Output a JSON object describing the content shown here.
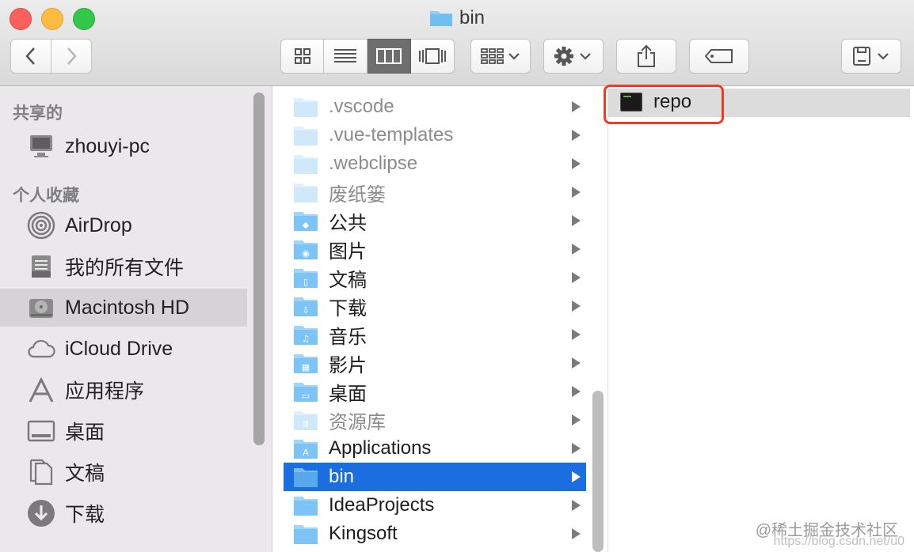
{
  "window": {
    "title": "bin"
  },
  "toolbar": {
    "back": "back",
    "forward": "forward",
    "view_modes": [
      "icon-view",
      "list-view",
      "column-view",
      "cover-flow-view"
    ],
    "active_view": "column-view",
    "arrange": "arrange",
    "action": "action",
    "share": "share",
    "tags": "tags",
    "eject": "eject"
  },
  "sidebar": {
    "shared_header": "共享的",
    "shared": [
      {
        "label": "zhouyi-pc",
        "icon": "computer-icon"
      }
    ],
    "favorites_header": "个人收藏",
    "favorites": [
      {
        "label": "AirDrop",
        "icon": "airdrop-icon"
      },
      {
        "label": "我的所有文件",
        "icon": "all-files-icon"
      },
      {
        "label": "Macintosh HD",
        "icon": "hard-drive-icon"
      },
      {
        "label": "iCloud Drive",
        "icon": "cloud-icon"
      },
      {
        "label": "应用程序",
        "icon": "applications-icon"
      },
      {
        "label": "桌面",
        "icon": "desktop-icon"
      },
      {
        "label": "文稿",
        "icon": "documents-icon"
      },
      {
        "label": "下载",
        "icon": "downloads-icon"
      }
    ]
  },
  "column1": {
    "items": [
      {
        "label": ".vscode",
        "dim": true
      },
      {
        "label": ".vue-templates",
        "dim": true
      },
      {
        "label": ".webclipse",
        "dim": true
      },
      {
        "label": "废纸篓",
        "dim": true
      },
      {
        "label": "公共",
        "dim": false
      },
      {
        "label": "图片",
        "dim": false
      },
      {
        "label": "文稿",
        "dim": false
      },
      {
        "label": "下载",
        "dim": false
      },
      {
        "label": "音乐",
        "dim": false
      },
      {
        "label": "影片",
        "dim": false
      },
      {
        "label": "桌面",
        "dim": false
      },
      {
        "label": "资源库",
        "dim": true
      },
      {
        "label": "Applications",
        "dim": false
      },
      {
        "label": "bin",
        "dim": false,
        "selected": true
      },
      {
        "label": "IdeaProjects",
        "dim": false
      },
      {
        "label": "Kingsoft",
        "dim": false
      }
    ]
  },
  "column2": {
    "items": [
      {
        "label": "repo",
        "icon": "terminal-executable-icon"
      }
    ]
  },
  "watermark": {
    "text": "@稀土掘金技术社区",
    "url_text": "https://blog.csdn.net/u0"
  },
  "colors": {
    "selection": "#1b6ee0",
    "highlight": "#ee3b22",
    "folder": "#7cc4f5"
  }
}
